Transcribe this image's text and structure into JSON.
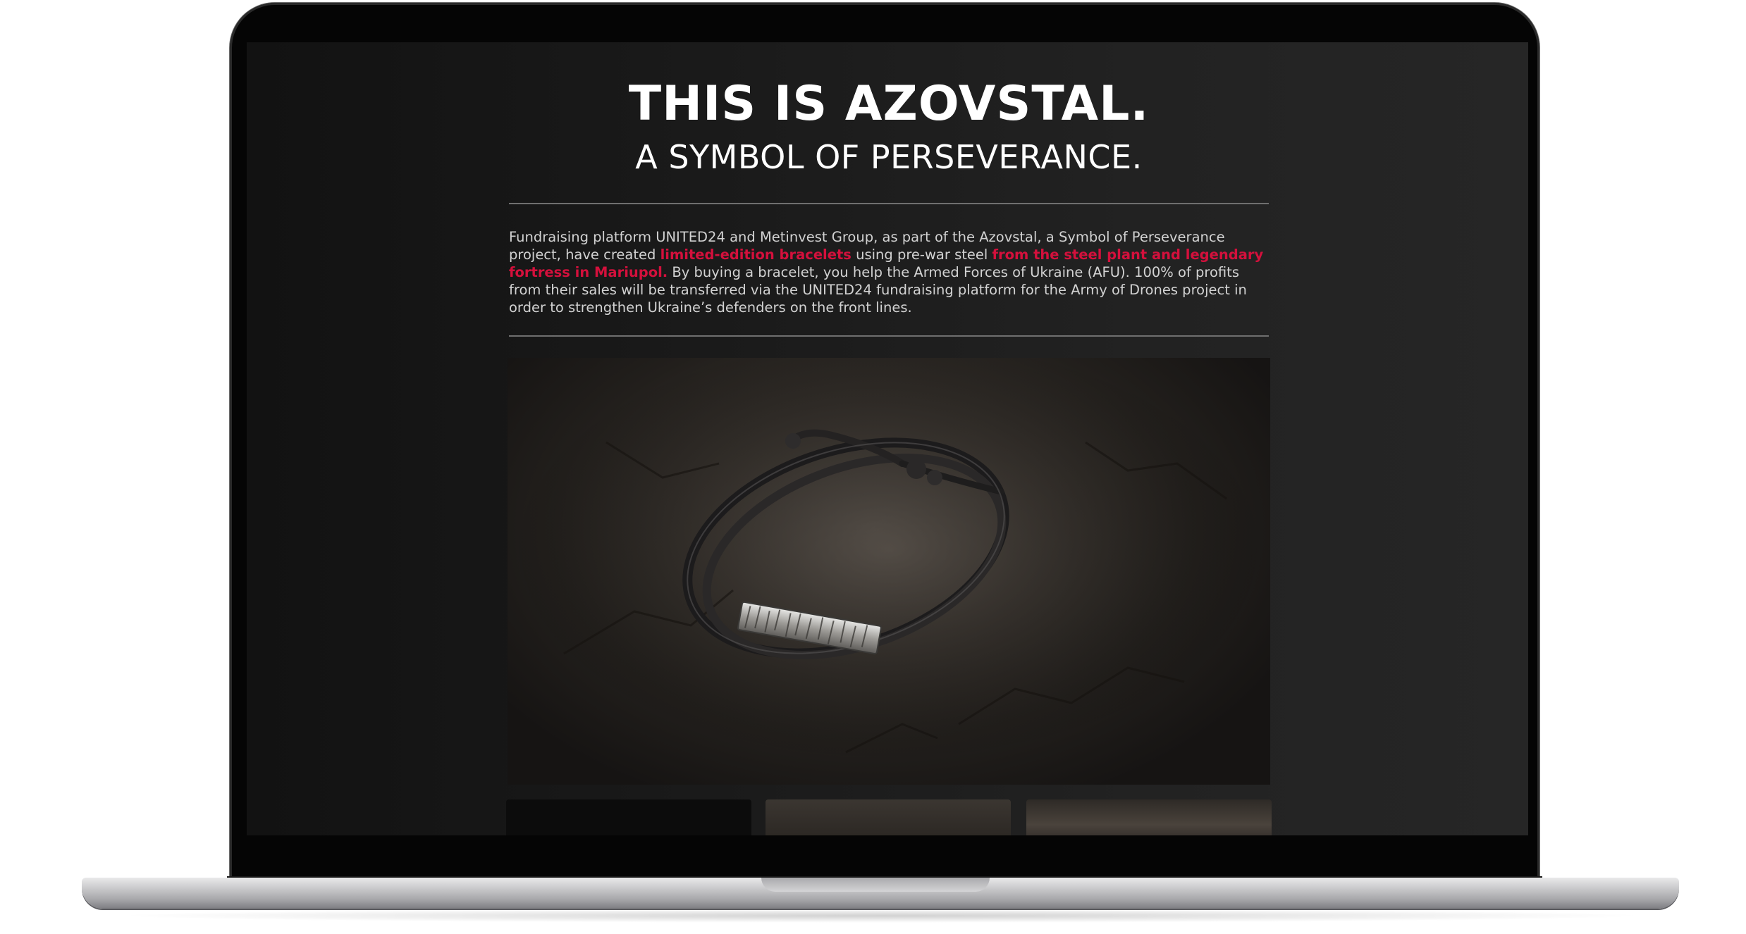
{
  "hero": {
    "title": "THIS IS AZOVSTAL.",
    "subtitle": "A SYMBOL OF PERSEVERANCE."
  },
  "intro": {
    "part1": "Fundraising platform UNITED24 and Metinvest Group, as part of the Azovstal, a Symbol of Perseverance project, have created ",
    "highlight1": "limited-edition bracelets",
    "part2": " using pre-war steel ",
    "highlight2": "from the steel plant and legendary fortress in Mariupol.",
    "part3": " By buying a bracelet, you help the Armed Forces of Ukraine (AFU). 100% of profits from their sales will be transferred via the UNITED24 fundraising platform for the Army of Drones project in order to strengthen Ukraine’s defenders on the front lines."
  },
  "colors": {
    "accent": "#d4103c",
    "page_background": "#1b1b1b",
    "text": "#ffffff"
  },
  "media": {
    "main_image": "bracelet-photo",
    "thumbnails": [
      "thumbnail-1",
      "thumbnail-2",
      "thumbnail-3"
    ]
  }
}
